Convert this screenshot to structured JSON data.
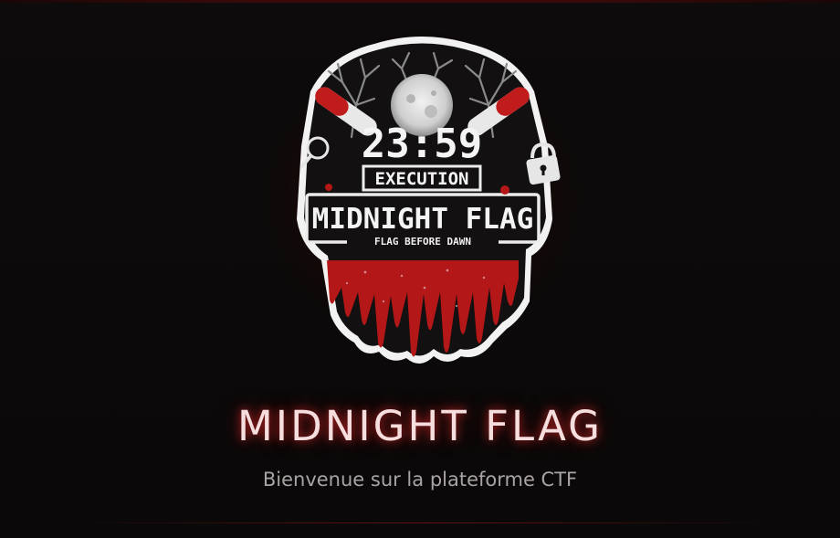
{
  "emblem": {
    "time": "23:59",
    "execution": "EXECUTION",
    "name": "MIDNIGHT FLAG",
    "tagline": "FLAG BEFORE DAWN",
    "icons": [
      "magnifier-icon",
      "padlock-icon",
      "chainsaw-icon",
      "moon-icon",
      "tree-icon"
    ]
  },
  "hero": {
    "title": "MIDNIGHT FLAG",
    "subtitle": "Bienvenue sur la plateforme CTF"
  },
  "colors": {
    "background": "#0c0a0a",
    "blood_red": "#b01818",
    "title_text": "#f6dede",
    "subtitle_text": "#a9a3a3"
  }
}
